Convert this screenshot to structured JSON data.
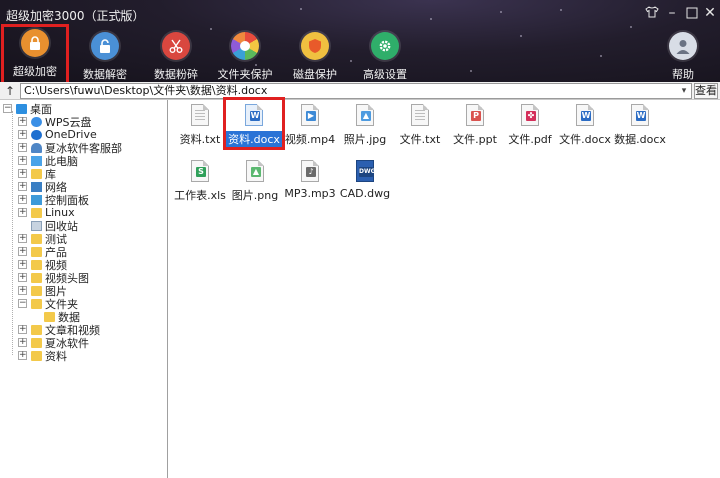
{
  "window": {
    "title": "超级加密3000（正式版）",
    "controls": [
      "shirt-icon",
      "minimize-icon",
      "maximize-icon",
      "close-icon"
    ]
  },
  "toolbar": {
    "items": [
      {
        "label": "超级加密",
        "icon": "lock-icon",
        "color": "#e8902f",
        "active": true
      },
      {
        "label": "数据解密",
        "icon": "unlock-icon",
        "color": "#4a90d6"
      },
      {
        "label": "数据粉碎",
        "icon": "scissors-icon",
        "color": "#d9473f"
      },
      {
        "label": "文件夹保护",
        "icon": "shutter-icon",
        "color": "#f0f0f0"
      },
      {
        "label": "磁盘保护",
        "icon": "shield-icon",
        "color": "#e85a2a"
      },
      {
        "label": "高级设置",
        "icon": "gear-icon",
        "color": "#2fae6a"
      }
    ],
    "help_label": "帮助"
  },
  "pathbar": {
    "path": "C:\\Users\\fuwu\\Desktop\\文件夹\\数据\\资料.docx",
    "view_label": "查看"
  },
  "tree": {
    "root": "桌面",
    "items": [
      {
        "label": "WPS云盘",
        "icon": "cloud-icon"
      },
      {
        "label": "OneDrive",
        "icon": "cloud-icon"
      },
      {
        "label": "夏冰软件客服部",
        "icon": "person-icon"
      },
      {
        "label": "此电脑",
        "icon": "computer-icon"
      },
      {
        "label": "库",
        "icon": "library-icon"
      },
      {
        "label": "网络",
        "icon": "network-icon"
      },
      {
        "label": "控制面板",
        "icon": "control-panel-icon"
      },
      {
        "label": "Linux",
        "icon": "folder-icon"
      },
      {
        "label": "回收站",
        "icon": "recycle-bin-icon"
      },
      {
        "label": "测试",
        "icon": "folder-icon"
      },
      {
        "label": "产品",
        "icon": "folder-icon"
      },
      {
        "label": "视频",
        "icon": "folder-icon"
      },
      {
        "label": "视频头图",
        "icon": "folder-icon"
      },
      {
        "label": "图片",
        "icon": "folder-icon"
      },
      {
        "label": "文件夹",
        "icon": "folder-icon"
      },
      {
        "label": "数据",
        "icon": "folder-icon"
      },
      {
        "label": "文章和视频",
        "icon": "folder-icon"
      },
      {
        "label": "夏冰软件",
        "icon": "folder-icon"
      },
      {
        "label": "资料",
        "icon": "folder-icon"
      }
    ]
  },
  "files": [
    {
      "name": "资料.txt",
      "type": "txt"
    },
    {
      "name": "资料.docx",
      "type": "docx",
      "selected": true
    },
    {
      "name": "视频.mp4",
      "type": "mp4"
    },
    {
      "name": "照片.jpg",
      "type": "jpg"
    },
    {
      "name": "文件.txt",
      "type": "txt"
    },
    {
      "name": "文件.ppt",
      "type": "ppt"
    },
    {
      "name": "文件.pdf",
      "type": "pdf"
    },
    {
      "name": "文件.docx",
      "type": "docx"
    },
    {
      "name": "数据.docx",
      "type": "docx"
    },
    {
      "name": "工作表.xls",
      "type": "xls"
    },
    {
      "name": "图片.png",
      "type": "png"
    },
    {
      "name": "MP3.mp3",
      "type": "mp3"
    },
    {
      "name": "CAD.dwg",
      "type": "dwg"
    }
  ],
  "colors": {
    "highlight_box": "#e02020",
    "selection": "#2a73d6"
  }
}
